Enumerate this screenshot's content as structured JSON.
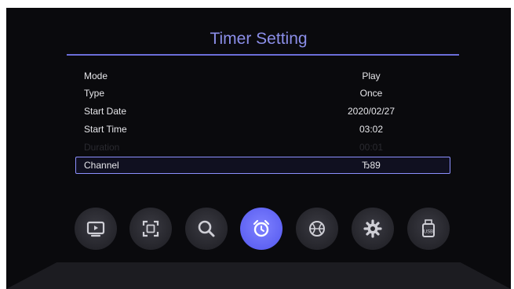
{
  "header": {
    "title": "Timer Setting"
  },
  "settings": [
    {
      "label": "Mode",
      "value": "Play"
    },
    {
      "label": "Type",
      "value": "Once"
    },
    {
      "label": "Start Date",
      "value": "2020/02/27"
    },
    {
      "label": "Start Time",
      "value": "03:02"
    },
    {
      "label": "Duration",
      "value": "00:01"
    },
    {
      "label": "Channel",
      "value": "Ђ89"
    }
  ],
  "menu_icons": [
    "tv-icon",
    "screen-icon",
    "search-icon",
    "alarm-clock-icon",
    "basketball-icon",
    "gear-icon",
    "usb-icon"
  ],
  "menu_labels": {
    "usb": "USB"
  },
  "colors": {
    "accent": "#6b6ed8",
    "active": "#5d61f2",
    "background": "#0a0a0d"
  }
}
